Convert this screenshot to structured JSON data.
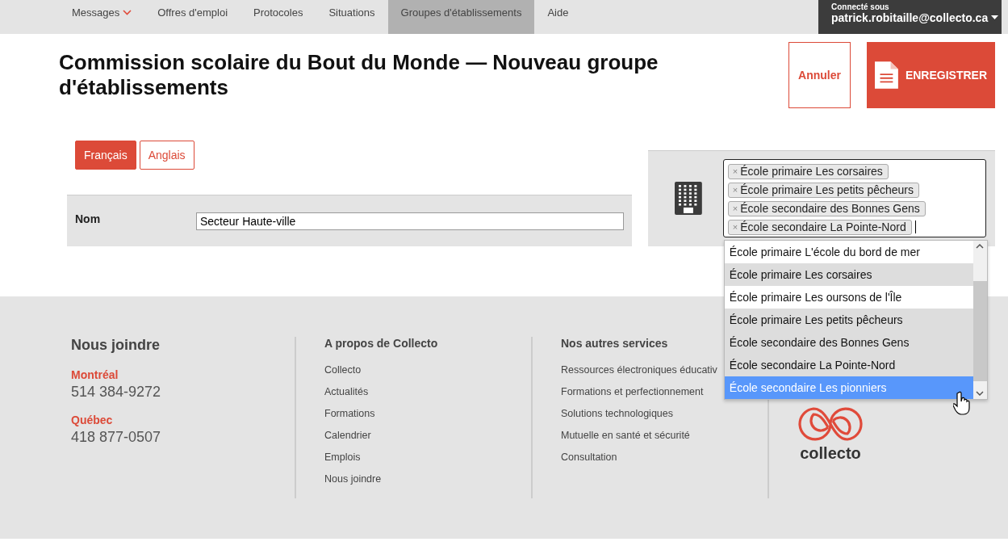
{
  "nav": {
    "items": [
      {
        "label": "Messages",
        "selected": false,
        "has_caret": true
      },
      {
        "label": "Offres d'emploi",
        "selected": false,
        "has_caret": false
      },
      {
        "label": "Protocoles",
        "selected": false,
        "has_caret": false
      },
      {
        "label": "Situations",
        "selected": false,
        "has_caret": false
      },
      {
        "label": "Groupes d'établissements",
        "selected": true,
        "has_caret": false
      },
      {
        "label": "Aide",
        "selected": false,
        "has_caret": false
      }
    ],
    "user": {
      "caption": "Connecté sous",
      "email": "patrick.robitaille@collecto.ca"
    }
  },
  "header": {
    "title": "Commission scolaire du Bout du Monde — Nouveau groupe d'établissements",
    "cancel": "Annuler",
    "save": "ENREGISTRER"
  },
  "language_tabs": [
    {
      "label": "Français",
      "selected": true
    },
    {
      "label": "Anglais",
      "selected": false
    }
  ],
  "name_field": {
    "label": "Nom",
    "value": "Secteur Haute-ville"
  },
  "schools": {
    "tags": [
      {
        "remove": "×",
        "label": "École primaire Les corsaires"
      },
      {
        "remove": "×",
        "label": "École primaire Les petits pêcheurs"
      },
      {
        "remove": "×",
        "label": "École secondaire des Bonnes Gens"
      },
      {
        "remove": "×",
        "label": "École secondaire La Pointe-Nord"
      }
    ],
    "options": [
      {
        "label": "École primaire L'école du bord de mer",
        "selected": false,
        "highlighted": false
      },
      {
        "label": "École primaire Les corsaires",
        "selected": true,
        "highlighted": false
      },
      {
        "label": "École primaire Les oursons de l'Île",
        "selected": false,
        "highlighted": false
      },
      {
        "label": "École primaire Les petits pêcheurs",
        "selected": true,
        "highlighted": false
      },
      {
        "label": "École secondaire des Bonnes Gens",
        "selected": true,
        "highlighted": false
      },
      {
        "label": "École secondaire La Pointe-Nord",
        "selected": true,
        "highlighted": false
      },
      {
        "label": "École secondaire Les pionniers",
        "selected": false,
        "highlighted": true
      }
    ]
  },
  "footer": {
    "contact": {
      "title": "Nous joindre",
      "offices": [
        {
          "city": "Montréal",
          "phone": "514 384-9272"
        },
        {
          "city": "Québec",
          "phone": "418 877-0507"
        }
      ]
    },
    "columns": [
      {
        "title": "A propos de Collecto",
        "links": [
          "Collecto",
          "Actualités",
          "Formations",
          "Calendrier",
          "Emplois",
          "Nous joindre"
        ]
      },
      {
        "title": "Nos autres services",
        "links": [
          "Ressources électroniques éducativ",
          "Formations et perfectionnement",
          "Solutions technologiques",
          "Mutuelle en santé et sécurité",
          "Consultation"
        ]
      }
    ],
    "logo_text": "collecto"
  }
}
